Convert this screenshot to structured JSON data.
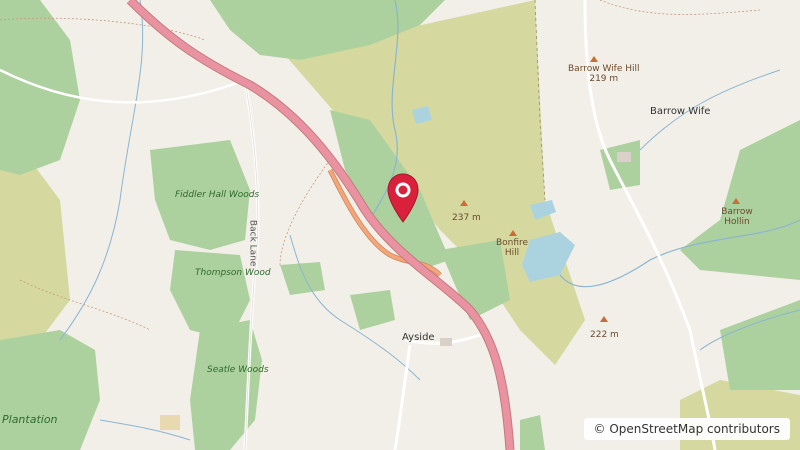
{
  "map": {
    "labels": {
      "fiddler": "Fiddler Hall Woods",
      "thompson": "Thompson Wood",
      "seatle": "Seatle Woods",
      "plantation": "Plantation",
      "back_lane": "Back Lane",
      "ayside": "Ayside",
      "barrow_wife": "Barrow Wife",
      "barrow_wife_hill": "Barrow Wife Hill",
      "barrow_wife_hill_elev": "219 m",
      "bonfire_hill": "Bonfire Hill",
      "barrow_hollin": "Barrow Hollin",
      "elev_237": "237 m",
      "elev_222": "222 m"
    },
    "attribution": "© OpenStreetMap contributors",
    "marker_icon": "map-pin-icon",
    "marker_color": "#d9213c",
    "colors": {
      "land": "#f2efe9",
      "woodland": "#add19e",
      "heath": "#d6d99f",
      "motorway": "#e892a2",
      "trunk": "#f6a57a",
      "water": "#aad3df",
      "river": "#8ab5d1"
    }
  }
}
